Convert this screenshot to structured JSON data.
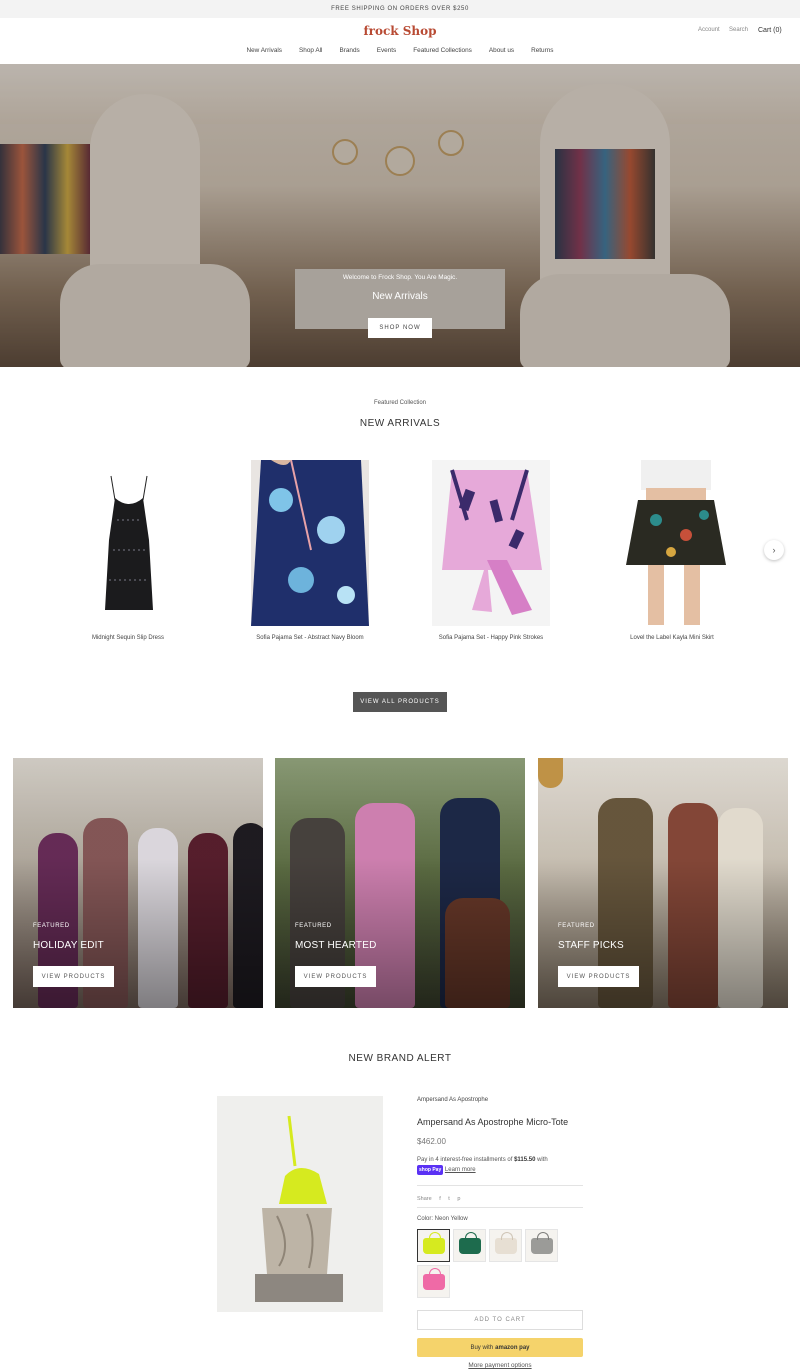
{
  "announcement": "FREE SHIPPING ON ORDERS OVER $250",
  "header": {
    "logo": "frock Shop",
    "account": "Account",
    "search": "Search",
    "cart": "Cart (0)",
    "nav": [
      "New Arrivals",
      "Shop All",
      "Brands",
      "Events",
      "Featured Collections",
      "About us",
      "Returns"
    ]
  },
  "hero": {
    "kicker": "Welcome to Frock Shop. You Are Magic.",
    "title": "New Arrivals",
    "button": "SHOP NOW"
  },
  "featured": {
    "kicker": "Featured Collection",
    "title": "NEW ARRIVALS",
    "products": [
      {
        "name": "Midnight Sequin Slip Dress"
      },
      {
        "name": "Sofia Pajama Set - Abstract Navy Bloom"
      },
      {
        "name": "Sofia Pajama Set - Happy Pink Strokes"
      },
      {
        "name": "Lovel the Label Kayla Mini Skirt"
      }
    ],
    "next_icon": "chevron-right-icon",
    "view_all": "VIEW ALL PRODUCTS"
  },
  "collections": [
    {
      "kicker": "FEATURED",
      "title": "HOLIDAY EDIT",
      "button": "VIEW PRODUCTS"
    },
    {
      "kicker": "FEATURED",
      "title": "MOST HEARTED",
      "button": "VIEW PRODUCTS"
    },
    {
      "kicker": "FEATURED",
      "title": "STAFF PICKS",
      "button": "VIEW PRODUCTS"
    }
  ],
  "brand_alert": {
    "title": "NEW BRAND ALERT",
    "vendor": "Ampersand As Apostrophe",
    "product_title": "Ampersand As Apostrophe Micro-Tote",
    "price": "$462.00",
    "installments_prefix": "Pay in 4 interest-free installments of",
    "installment_amount": "$115.50",
    "installments_suffix": "with",
    "shop_pay": "shop Pay",
    "learn_more": "Learn more",
    "share": "Share",
    "share_icons": [
      "f",
      "t",
      "p"
    ],
    "color_label": "Color: Neon Yellow",
    "swatches": [
      {
        "color": "#d6ea1f",
        "selected": true
      },
      {
        "color": "#1d6b4d",
        "selected": false
      },
      {
        "color": "#e7dfd3",
        "selected": false
      },
      {
        "color": "#9b9b98",
        "selected": false
      },
      {
        "color": "#ef6aa6",
        "selected": false
      }
    ],
    "add_to_cart": "ADD TO CART",
    "amazon_prefix": "Buy with",
    "amazon_brand": "amazon pay",
    "more_payment": "More payment options"
  },
  "colors": {
    "logo": "#b84a33",
    "dark_button": "#555555",
    "amazon": "#f5d36b"
  }
}
